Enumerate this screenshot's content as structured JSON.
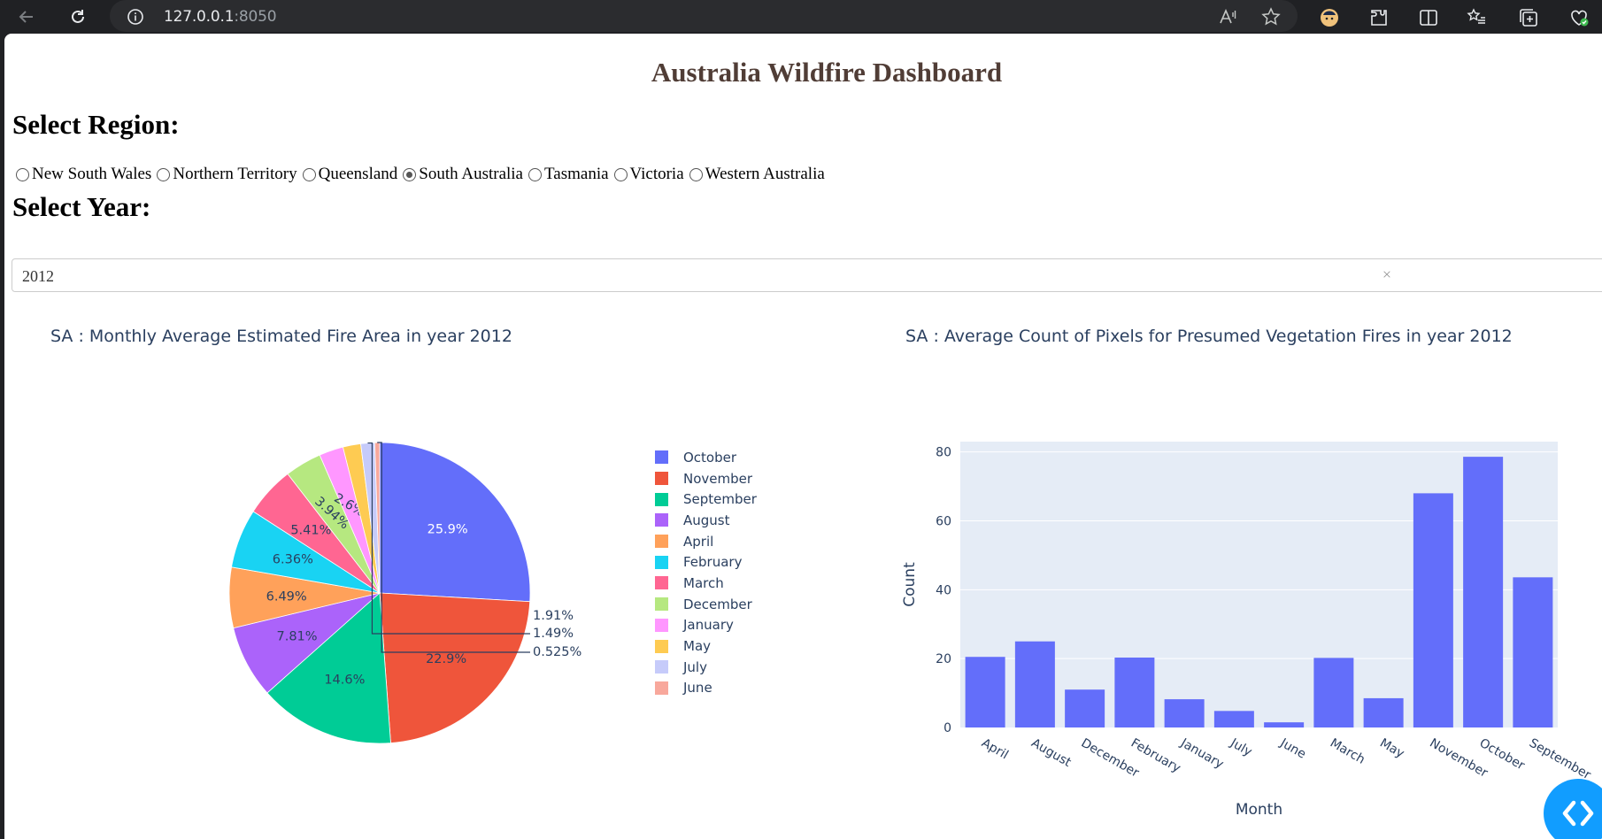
{
  "browser": {
    "url_host": "127.0.0.1",
    "url_port": ":8050"
  },
  "page": {
    "title": "Australia Wildfire Dashboard",
    "region_label": "Select Region:",
    "year_label": "Select Year:",
    "regions": [
      {
        "label": "New South Wales",
        "checked": false
      },
      {
        "label": "Northern Territory",
        "checked": false
      },
      {
        "label": "Queensland",
        "checked": false
      },
      {
        "label": "South Australia",
        "checked": true
      },
      {
        "label": "Tasmania",
        "checked": false
      },
      {
        "label": "Victoria",
        "checked": false
      },
      {
        "label": "Western Australia",
        "checked": false
      }
    ],
    "year_value": "2012",
    "dropdown_clear": "×"
  },
  "pie": {
    "title": "SA : Monthly Average Estimated Fire Area in year 2012"
  },
  "bar": {
    "title": "SA : Average Count of Pixels for Presumed Vegetation Fires in year 2012"
  },
  "chart_data": [
    {
      "type": "pie",
      "title": "SA : Monthly Average Estimated Fire Area in year 2012",
      "slices": [
        {
          "label": "October",
          "percent": 25.9,
          "text": "25.9%",
          "color": "#636efa"
        },
        {
          "label": "November",
          "percent": 22.9,
          "text": "22.9%",
          "color": "#ef553b"
        },
        {
          "label": "September",
          "percent": 14.6,
          "text": "14.6%",
          "color": "#00cc96"
        },
        {
          "label": "August",
          "percent": 7.81,
          "text": "7.81%",
          "color": "#ab63fa"
        },
        {
          "label": "April",
          "percent": 6.49,
          "text": "6.49%",
          "color": "#ffa15a"
        },
        {
          "label": "February",
          "percent": 6.36,
          "text": "6.36%",
          "color": "#19d3f3"
        },
        {
          "label": "March",
          "percent": 5.41,
          "text": "5.41%",
          "color": "#ff6692"
        },
        {
          "label": "December",
          "percent": 3.94,
          "text": "3.94%",
          "color": "#b6e880"
        },
        {
          "label": "January",
          "percent": 2.6,
          "text": "2.6%",
          "color": "#ff97ff"
        },
        {
          "label": "May",
          "percent": 1.91,
          "text": "1.91%",
          "color": "#fecb52"
        },
        {
          "label": "July",
          "percent": 1.49,
          "text": "1.49%",
          "color": "#c6cbfa"
        },
        {
          "label": "June",
          "percent": 0.525,
          "text": "0.525%",
          "color": "#f8a89c"
        }
      ],
      "legend_position": "right"
    },
    {
      "type": "bar",
      "title": "SA : Average Count of Pixels for Presumed Vegetation Fires in year 2012",
      "categories": [
        "April",
        "August",
        "December",
        "February",
        "January",
        "July",
        "June",
        "March",
        "May",
        "November",
        "October",
        "September"
      ],
      "values": [
        20.5,
        25,
        11,
        20.3,
        8.2,
        4.8,
        1.5,
        20.2,
        8.5,
        68,
        78.6,
        43.6
      ],
      "xlabel": "Month",
      "ylabel": "Count",
      "ylim": [
        0,
        83
      ],
      "yticks": [
        0,
        20,
        40,
        60,
        80
      ],
      "color": "#636efa",
      "grid": true
    }
  ]
}
